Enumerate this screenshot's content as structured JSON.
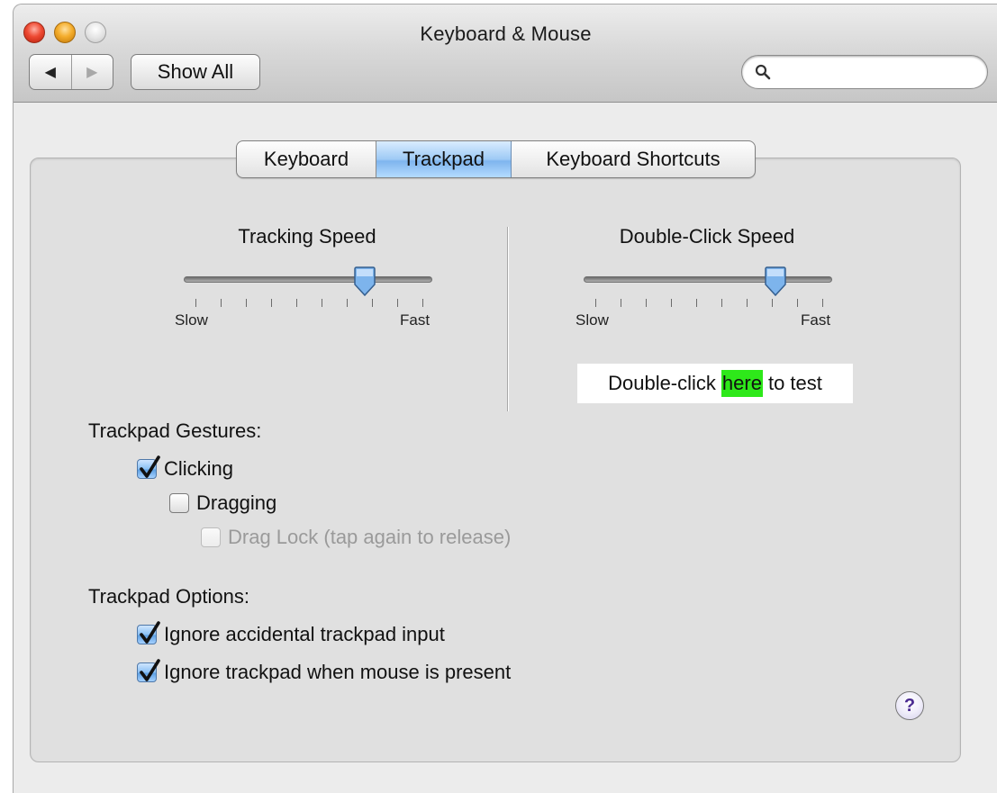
{
  "window": {
    "title": "Keyboard & Mouse"
  },
  "toolbar": {
    "back_icon": "back-arrow-icon",
    "forward_icon": "forward-arrow-icon",
    "show_all_label": "Show All",
    "search": {
      "value": "",
      "placeholder": "",
      "icon": "search-icon"
    }
  },
  "tabs": [
    {
      "label": "Keyboard",
      "selected": false
    },
    {
      "label": "Trackpad",
      "selected": true
    },
    {
      "label": "Keyboard Shortcuts",
      "selected": false
    }
  ],
  "tracking_speed": {
    "title": "Tracking Speed",
    "min_label": "Slow",
    "max_label": "Fast",
    "value_fraction": 0.73,
    "tick_count": 10
  },
  "double_click_speed": {
    "title": "Double-Click Speed",
    "min_label": "Slow",
    "max_label": "Fast",
    "value_fraction": 0.77,
    "tick_count": 10,
    "test_prefix": "Double-click",
    "test_highlight": "here",
    "test_suffix": "to test"
  },
  "gestures": {
    "heading": "Trackpad Gestures:",
    "items": [
      {
        "label": "Clicking",
        "checked": true,
        "enabled": true
      },
      {
        "label": "Dragging",
        "checked": false,
        "enabled": true
      },
      {
        "label": "Drag Lock (tap again to release)",
        "checked": false,
        "enabled": false
      }
    ]
  },
  "options": {
    "heading": "Trackpad Options:",
    "items": [
      {
        "label": "Ignore accidental trackpad input",
        "checked": true,
        "enabled": true
      },
      {
        "label": "Ignore trackpad when mouse is present",
        "checked": true,
        "enabled": true
      }
    ]
  },
  "help": {
    "label": "?",
    "icon": "help-icon"
  },
  "colors": {
    "selection_blue": "#8ac0f4",
    "test_highlight": "#2ee81a"
  }
}
